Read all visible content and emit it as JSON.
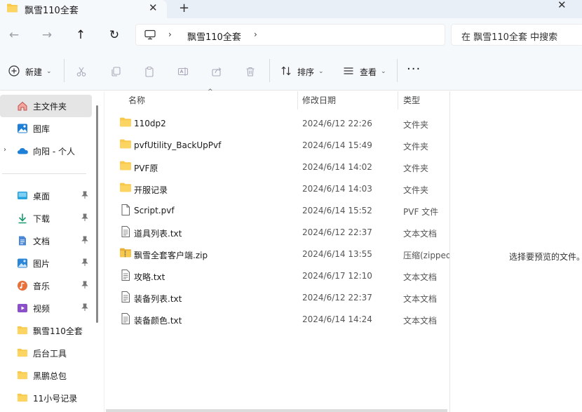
{
  "tab": {
    "title": "飘雪110全套",
    "close": "✕",
    "new_tab": "+"
  },
  "window": {
    "close": "✕"
  },
  "nav": {
    "back": "←",
    "forward": "→",
    "up": "↑",
    "refresh": "↻"
  },
  "address": {
    "chevron": "›",
    "crumb": "飘雪110全套"
  },
  "search": {
    "placeholder": "在 飘雪110全套 中搜索"
  },
  "toolbar": {
    "new_label": "新建",
    "sort_label": "排序",
    "view_label": "查看",
    "more_label": "···",
    "caret": "⌄"
  },
  "sidebar": {
    "expander": "›",
    "top_items": [
      {
        "label": "主文件夹",
        "icon": "home-icon"
      },
      {
        "label": "图库",
        "icon": "gallery-icon"
      },
      {
        "label": "向阳 - 个人",
        "icon": "cloud-icon"
      }
    ],
    "pinned_items": [
      {
        "label": "桌面",
        "icon": "desktop-icon"
      },
      {
        "label": "下载",
        "icon": "download-icon"
      },
      {
        "label": "文档",
        "icon": "document-icon"
      },
      {
        "label": "图片",
        "icon": "pictures-icon"
      },
      {
        "label": "音乐",
        "icon": "music-icon"
      },
      {
        "label": "视频",
        "icon": "video-icon"
      }
    ],
    "folder_items": [
      {
        "label": "飘雪110全套"
      },
      {
        "label": "后台工具"
      },
      {
        "label": "黑鹏总包"
      },
      {
        "label": "11小号记录"
      }
    ]
  },
  "columns": {
    "name": "名称",
    "date": "修改日期",
    "type": "类型",
    "sort_arrow": "^"
  },
  "files": [
    {
      "name": "110dp2",
      "date": "2024/6/12 22:26",
      "type": "文件夹",
      "icon": "folder-icon"
    },
    {
      "name": "pvfUtility_BackUpPvf",
      "date": "2024/6/14 15:49",
      "type": "文件夹",
      "icon": "folder-icon"
    },
    {
      "name": "PVF原",
      "date": "2024/6/14 14:02",
      "type": "文件夹",
      "icon": "folder-icon"
    },
    {
      "name": "开服记录",
      "date": "2024/6/14 14:03",
      "type": "文件夹",
      "icon": "folder-icon"
    },
    {
      "name": "Script.pvf",
      "date": "2024/6/14 15:52",
      "type": "PVF 文件",
      "icon": "file-icon"
    },
    {
      "name": "道具列表.txt",
      "date": "2024/6/12 22:37",
      "type": "文本文档",
      "icon": "text-file-icon"
    },
    {
      "name": "飘雪全套客户端.zip",
      "date": "2024/6/14 13:55",
      "type": "压缩(zipped)",
      "icon": "zip-folder-icon"
    },
    {
      "name": "攻略.txt",
      "date": "2024/6/17 12:10",
      "type": "文本文档",
      "icon": "text-file-icon"
    },
    {
      "name": "装备列表.txt",
      "date": "2024/6/12 22:37",
      "type": "文本文档",
      "icon": "text-file-icon"
    },
    {
      "name": "装备颜色.txt",
      "date": "2024/6/14 14:24",
      "type": "文本文档",
      "icon": "text-file-icon"
    }
  ],
  "preview": {
    "message": "选择要预览的文件。"
  },
  "colors": {
    "folder": "#f8c94a",
    "accent": "#0067c0",
    "chrome": "#f6f9fc"
  }
}
